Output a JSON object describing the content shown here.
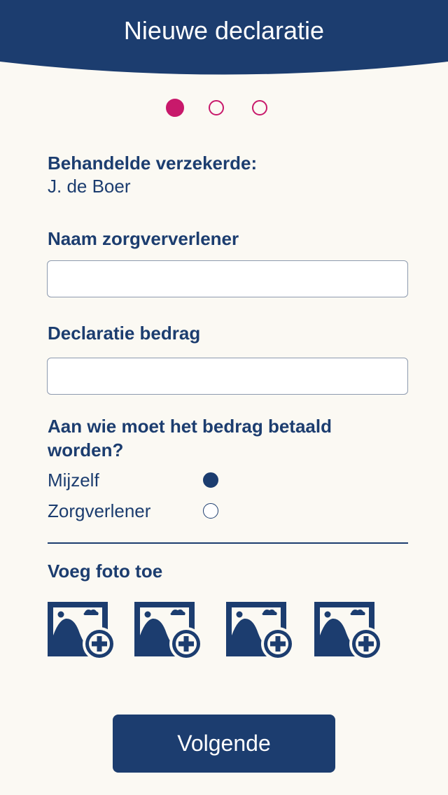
{
  "header": {
    "title": "Nieuwe declaratie"
  },
  "steps": {
    "total": 3,
    "current": 1
  },
  "insured": {
    "label": "Behandelde verzekerde:",
    "name": "J. de Boer"
  },
  "provider_name": {
    "label": "Naam zorgververlener",
    "value": "",
    "placeholder": ""
  },
  "amount": {
    "label": "Declaratie bedrag",
    "value": "",
    "placeholder": ""
  },
  "payee": {
    "question": "Aan wie moet het bedrag betaald worden?",
    "options": [
      {
        "label": "Mijzelf",
        "selected": true
      },
      {
        "label": "Zorgverlener",
        "selected": false
      }
    ]
  },
  "photos": {
    "label": "Voeg foto toe",
    "slots": 4,
    "icon": "add-photo-icon"
  },
  "next_button": {
    "label": "Volgende"
  },
  "colors": {
    "primary": "#1c3d6f",
    "accent": "#c8196b",
    "background": "#fbf9f3"
  }
}
